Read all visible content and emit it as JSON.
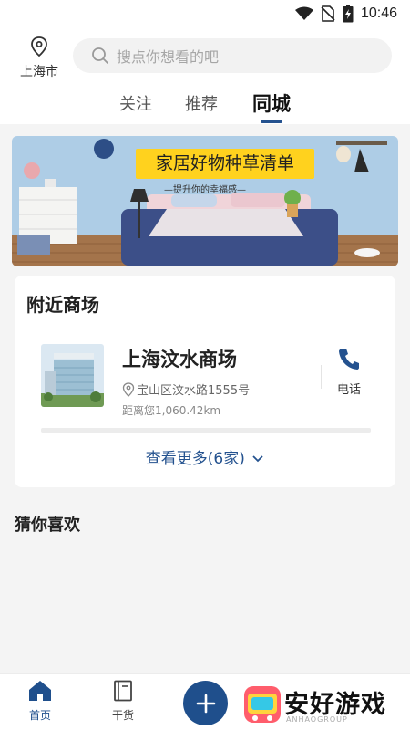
{
  "status_bar": {
    "time": "10:46"
  },
  "header": {
    "location": "上海市",
    "search_placeholder": "搜点你想看的吧",
    "tabs": [
      {
        "label": "关注"
      },
      {
        "label": "推荐"
      },
      {
        "label": "同城"
      }
    ],
    "active_tab": "同城"
  },
  "banner": {
    "title": "家居好物种草清单",
    "subtitle": "—提升你的幸福感—"
  },
  "nearby": {
    "title": "附近商场",
    "mall": {
      "name": "上海汶水商场",
      "address": "宝山区汶水路1555号",
      "distance": "距离您1,060.42km",
      "phone_label": "电话"
    },
    "see_more": "查看更多(6家)"
  },
  "guess": {
    "title": "猜你喜欢"
  },
  "bottom_nav": {
    "items": [
      {
        "label": "首页"
      },
      {
        "label": "干货"
      }
    ]
  },
  "watermark": {
    "text": "安好游戏",
    "sub": "ANHAOGROUP"
  },
  "colors": {
    "brand": "#24528f",
    "active_nav": "#1f4f8c",
    "banner_tag": "#ffd21e"
  }
}
